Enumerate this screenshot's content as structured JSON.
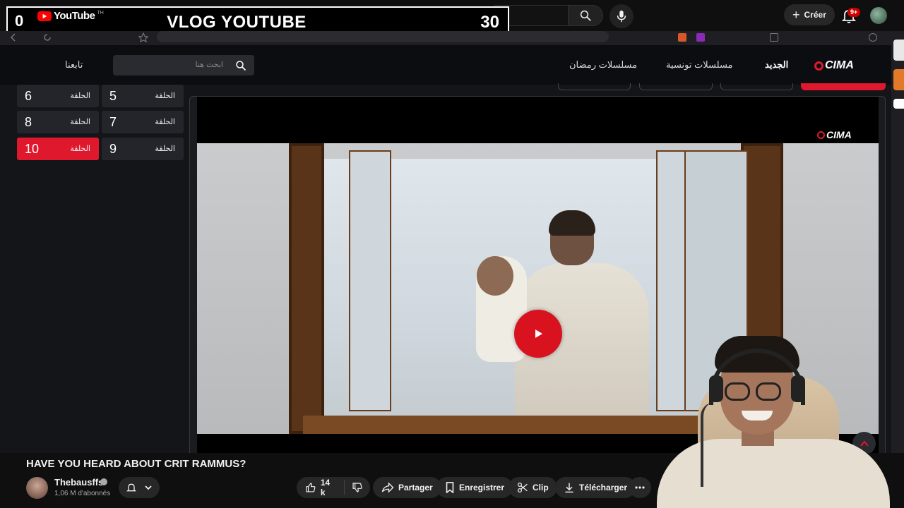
{
  "banner": {
    "left_value": "0",
    "logo_text": "YouTube",
    "logo_sup": "TH",
    "title": "VLOG YOUTUBE",
    "right_value": "30"
  },
  "youtube_header": {
    "create_label": "Créer",
    "notification_badge": "9+"
  },
  "site": {
    "logo": "CIMA",
    "nav": {
      "new": "الجديد",
      "tunisian_series": "مسلسلات تونسية",
      "ramadan_series": "مسلسلات رمضان"
    },
    "search_placeholder": "ابحث هنا",
    "follow": "تابعنا",
    "episode_label": "الحلقة",
    "episodes": [
      {
        "number": "5",
        "label": "الحلقة",
        "active": false
      },
      {
        "number": "6",
        "label": "الحلقة",
        "active": false
      },
      {
        "number": "7",
        "label": "الحلقة",
        "active": false
      },
      {
        "number": "8",
        "label": "الحلقة",
        "active": false
      },
      {
        "number": "9",
        "label": "الحلقة",
        "active": false
      },
      {
        "number": "10",
        "label": "الحلقة",
        "active": true
      }
    ],
    "video_logo": "CIMA",
    "video_progress": 0.93
  },
  "video": {
    "title": "HAVE YOU HEARD ABOUT CRIT RAMMUS?",
    "channel_name": "Thebausffs",
    "subscribers": "1,06 M d'abonnés",
    "likes": "14 k",
    "actions": {
      "share": "Partager",
      "save": "Enregistrer",
      "clip": "Clip",
      "download": "Télécharger"
    }
  },
  "colors": {
    "accent_red": "#e0182d",
    "youtube_red": "#ff0000",
    "background": "#0f0f0f"
  }
}
